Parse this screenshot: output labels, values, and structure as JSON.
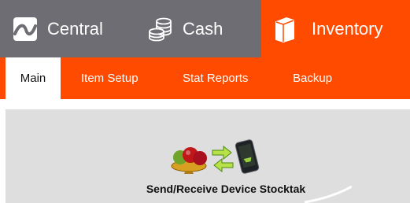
{
  "top_tabs": {
    "central": {
      "label": "Central",
      "icon": "central-logo-icon"
    },
    "cash": {
      "label": "Cash",
      "icon": "coins-icon"
    },
    "inventory": {
      "label": "Inventory",
      "icon": "box-icon",
      "active": true
    }
  },
  "sub_tabs": {
    "main": {
      "label": "Main",
      "active": true
    },
    "item_setup": {
      "label": "Item Setup"
    },
    "stat_reports": {
      "label": "Stat Reports"
    },
    "backup": {
      "label": "Backup"
    }
  },
  "content": {
    "stocktake_button": {
      "label": "Send/Receive Device Stocktak",
      "icon": "fruit-bowl-phone-sync-icon"
    }
  },
  "colors": {
    "top_bar": "#6d6d73",
    "accent": "#ff4b00",
    "content_bg": "#dededf"
  }
}
